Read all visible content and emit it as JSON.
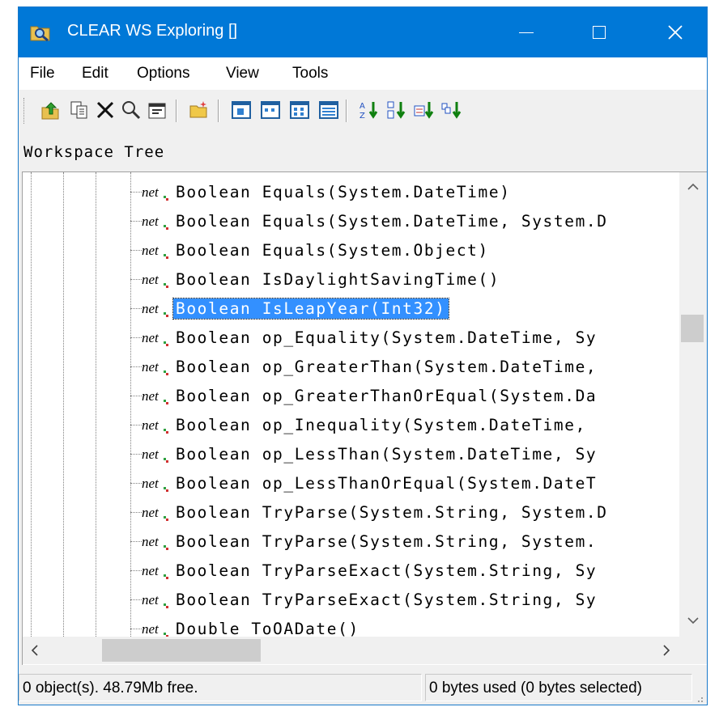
{
  "window": {
    "title": "CLEAR WS Exploring []",
    "controls": {
      "minimize": "—",
      "maximize": "☐",
      "close": "✕"
    }
  },
  "menu": [
    "File",
    "Edit",
    "Options",
    "View",
    "Tools"
  ],
  "toolbar": {
    "buttons": [
      "up-folder-icon",
      "copy-icon",
      "delete-icon",
      "find-icon",
      "properties-icon",
      "open-folder-icon",
      "large-icons-view-icon",
      "small-icons-view-icon",
      "list-view-icon",
      "details-view-icon",
      "sort-by-name-icon",
      "sort-by-type-icon",
      "sort-by-size-icon",
      "sort-by-date-icon"
    ]
  },
  "panel": {
    "header": "Workspace Tree"
  },
  "tree": {
    "icon_label": "net",
    "items": [
      {
        "label": "Boolean Equals(System.DateTime)",
        "selected": false
      },
      {
        "label": "Boolean Equals(System.DateTime, System.D",
        "selected": false
      },
      {
        "label": "Boolean Equals(System.Object)",
        "selected": false
      },
      {
        "label": "Boolean IsDaylightSavingTime()",
        "selected": false
      },
      {
        "label": "Boolean IsLeapYear(Int32)",
        "selected": true
      },
      {
        "label": "Boolean op_Equality(System.DateTime, Sy",
        "selected": false
      },
      {
        "label": "Boolean op_GreaterThan(System.DateTime,",
        "selected": false
      },
      {
        "label": "Boolean op_GreaterThanOrEqual(System.Da",
        "selected": false
      },
      {
        "label": "Boolean op_Inequality(System.DateTime,",
        "selected": false
      },
      {
        "label": "Boolean op_LessThan(System.DateTime, Sy",
        "selected": false
      },
      {
        "label": "Boolean op_LessThanOrEqual(System.DateT",
        "selected": false
      },
      {
        "label": "Boolean TryParse(System.String, System.D",
        "selected": false
      },
      {
        "label": "Boolean TryParse(System.String, System.",
        "selected": false
      },
      {
        "label": "Boolean TryParseExact(System.String, Sy",
        "selected": false
      },
      {
        "label": "Boolean TryParseExact(System.String, Sy",
        "selected": false
      },
      {
        "label": "Double ToOADate()",
        "selected": false
      }
    ]
  },
  "scrollbars": {
    "up": "▲",
    "down": "▼",
    "left": "<",
    "right": ">"
  },
  "status": {
    "left": "0 object(s). 48.79Mb free.",
    "right": "0 bytes used (0 bytes selected)"
  },
  "colors": {
    "titlebar": "#0078d7",
    "selection": "#3390ff"
  }
}
